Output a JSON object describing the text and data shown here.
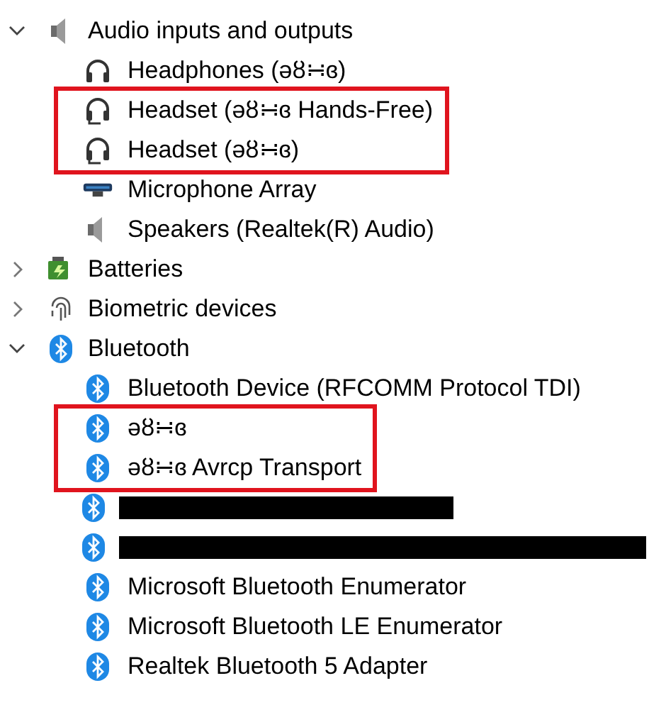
{
  "tree": [
    {
      "label": "Audio inputs and outputs",
      "kind": "speaker",
      "expanded": true,
      "children": [
        {
          "label": "Headphones (əȣ∺ɞ)",
          "kind": "headphones",
          "highlighted": false
        },
        {
          "label": "Headset (əȣ∺ɞ Hands-Free)",
          "kind": "headset",
          "highlighted": true
        },
        {
          "label": "Headset (əȣ∺ɞ)",
          "kind": "headset",
          "highlighted": true
        },
        {
          "label": "Microphone Array",
          "kind": "microphone",
          "highlighted": false
        },
        {
          "label": "Speakers (Realtek(R) Audio)",
          "kind": "speaker",
          "highlighted": false
        }
      ]
    },
    {
      "label": "Batteries",
      "kind": "battery",
      "expanded": false
    },
    {
      "label": "Biometric devices",
      "kind": "fingerprint",
      "expanded": false
    },
    {
      "label": "Bluetooth",
      "kind": "bluetooth",
      "expanded": true,
      "children": [
        {
          "label": "Bluetooth Device (RFCOMM Protocol TDI)",
          "kind": "bluetooth",
          "highlighted": false
        },
        {
          "label": "əȣ∺ɞ",
          "kind": "bluetooth",
          "highlighted": true
        },
        {
          "label": "əȣ∺ɞ Avrcp Transport",
          "kind": "bluetooth",
          "highlighted": true
        },
        {
          "kind": "redacted",
          "highlighted": false
        },
        {
          "kind": "redacted",
          "highlighted": false
        },
        {
          "label": "Microsoft Bluetooth Enumerator",
          "kind": "bluetooth",
          "highlighted": false
        },
        {
          "label": "Microsoft Bluetooth LE Enumerator",
          "kind": "bluetooth",
          "highlighted": false
        },
        {
          "label": "Realtek Bluetooth 5 Adapter",
          "kind": "bluetooth",
          "highlighted": false
        }
      ]
    }
  ]
}
